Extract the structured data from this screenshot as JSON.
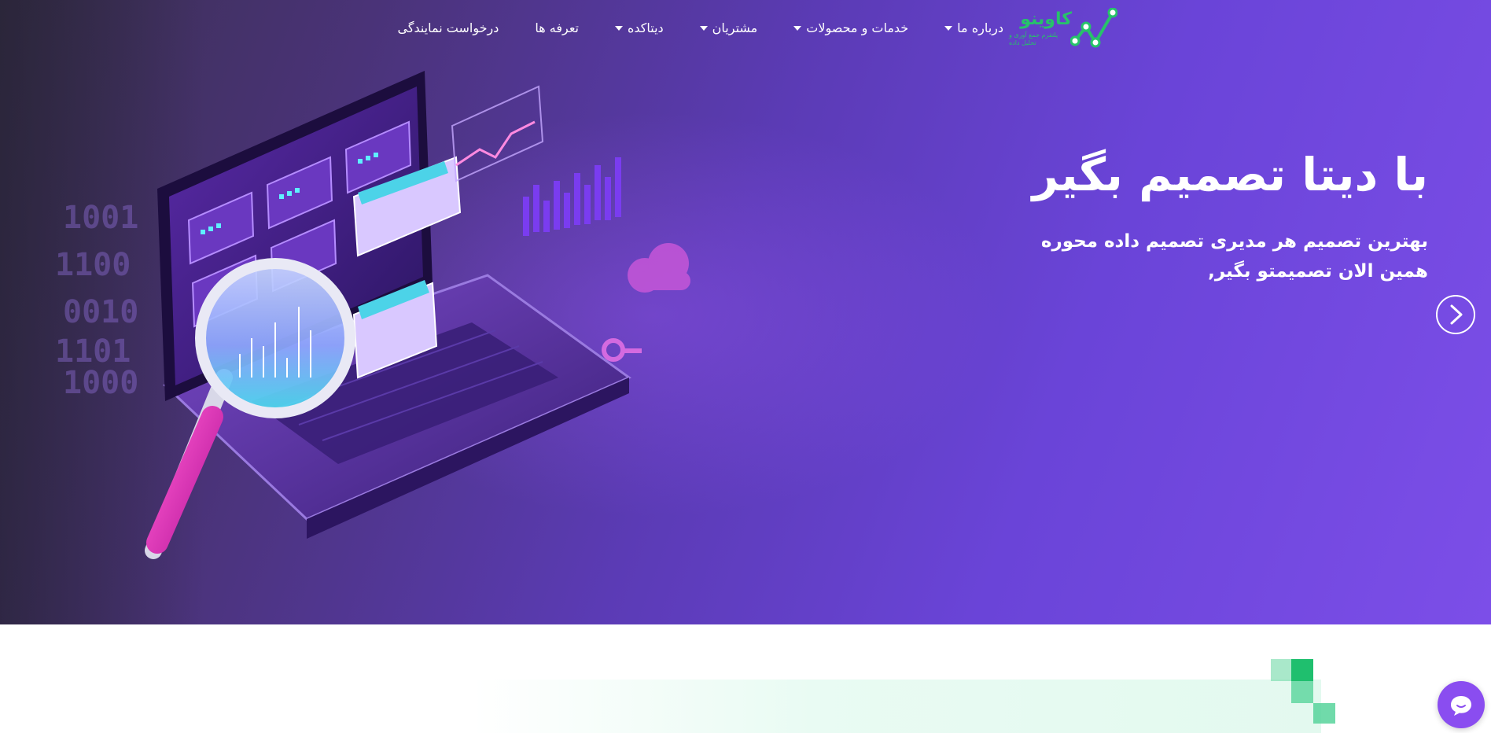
{
  "brand": {
    "name": "کاوینو",
    "tagline": "پلتفرم جمع آوری و تحلیل داده",
    "color": "#27c26a"
  },
  "nav": {
    "items": [
      {
        "label": "درباره ما",
        "dropdown": true
      },
      {
        "label": "خدمات و محصولات",
        "dropdown": true
      },
      {
        "label": "مشتریان",
        "dropdown": true
      },
      {
        "label": "دیتاکده",
        "dropdown": true
      },
      {
        "label": "تعرفه ها",
        "dropdown": false
      },
      {
        "label": "درخواست نمایندگی",
        "dropdown": false
      }
    ]
  },
  "hero": {
    "title": "با دیتا تصمیم بگیر",
    "subtitle_line1": "بهترین تصمیم هر مدیری تصمیم داده محوره",
    "subtitle_line2": "همین الان تصمیمتو بگیر,",
    "next_icon": "chevron-right-icon",
    "gradient_start": "#3a2f4f",
    "gradient_end": "#7c4ee8"
  },
  "illustration": {
    "binary_text": [
      "1001",
      "1100",
      "0010",
      "1101",
      "1000"
    ]
  },
  "chat": {
    "icon": "chat-bubble-icon",
    "color": "#8a4df0"
  }
}
